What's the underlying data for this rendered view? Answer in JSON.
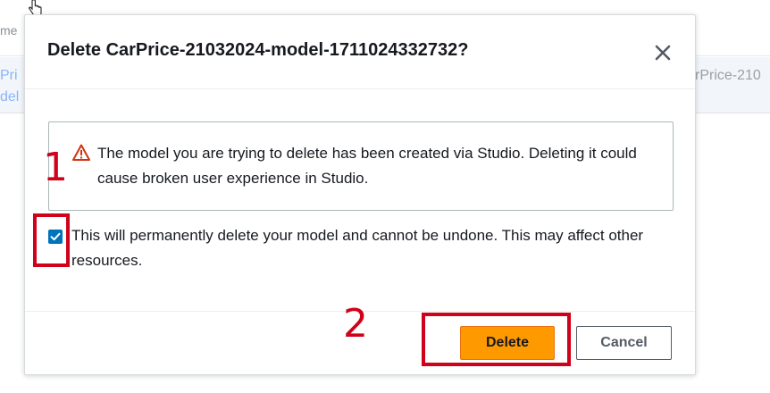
{
  "background": {
    "header_fragment": "me",
    "row_fragment_left_1": "Pri",
    "row_fragment_left_2": "del",
    "row_fragment_right": "rPrice-210"
  },
  "modal": {
    "title": "Delete CarPrice-21032024-model-1711024332732?",
    "close_icon": "close-icon",
    "alert": {
      "icon": "warning-icon",
      "text": "The model you are trying to delete has been created via Studio. Deleting it could cause broken user experience in Studio."
    },
    "confirm": {
      "checked": true,
      "text": "This will permanently delete your model and cannot be undone. This may affect other resources."
    },
    "footer": {
      "delete_label": "Delete",
      "cancel_label": "Cancel"
    }
  },
  "annotations": {
    "step_1": "1",
    "step_2": "2"
  },
  "colors": {
    "primary_button": "#ff9900",
    "checkbox": "#0073bb",
    "warning": "#d13212",
    "annotation": "#d0021b"
  }
}
